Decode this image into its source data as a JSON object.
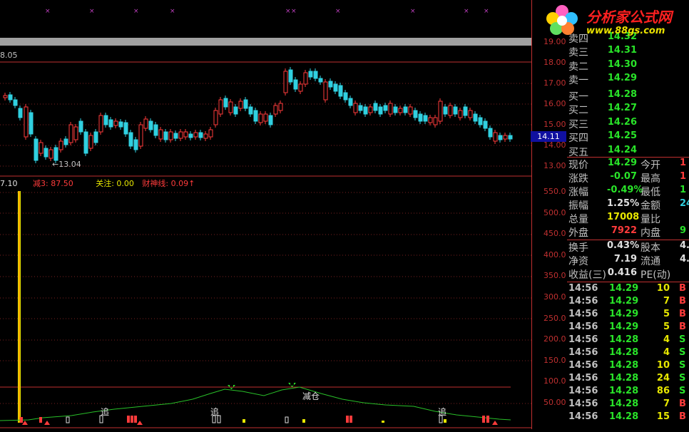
{
  "logo": {
    "title": "分析家公式网",
    "url": "www.88gs.com"
  },
  "main_chart": {
    "top_left_value": "8.05",
    "low_marker": "←13.04",
    "price_tag": "14.11",
    "price_axis": [
      "19.00",
      "18.00",
      "17.00",
      "16.00",
      "15.00",
      "14.00",
      "13.00"
    ]
  },
  "indicator": {
    "legend": [
      {
        "text": "7.10",
        "color": "#e0e0e0"
      },
      {
        "text": "减3: 87.50",
        "color": "#ff3b3b"
      },
      {
        "text": "关注: 0.00",
        "color": "#e7e700"
      },
      {
        "text": "财神线: 0.09↑",
        "color": "#ff3b3b"
      }
    ],
    "axis": [
      "550.0",
      "500.0",
      "450.0",
      "400.0",
      "350.0",
      "300.0",
      "250.0",
      "200.0",
      "150.0",
      "100.0",
      "50.00"
    ],
    "labels": [
      "追",
      "追",
      "减仓",
      "追"
    ]
  },
  "order_book": {
    "partial_top": "卖四",
    "partial_top_val": "14.32",
    "rows": [
      {
        "label": "卖三",
        "value": "14.31"
      },
      {
        "label": "卖二",
        "value": "14.30"
      },
      {
        "label": "卖一",
        "value": "14.29"
      },
      {
        "label": "买一",
        "value": "14.28"
      },
      {
        "label": "买二",
        "value": "14.27"
      },
      {
        "label": "买三",
        "value": "14.26"
      },
      {
        "label": "买四",
        "value": "14.25"
      },
      {
        "label": "买五",
        "value": "14.24"
      }
    ]
  },
  "quote": {
    "rows": [
      {
        "l1": "现价",
        "v1": "14.29",
        "c1": "#29e329",
        "l2": "今开",
        "v2": "1",
        "c2": "#ff3b3b"
      },
      {
        "l1": "涨跌",
        "v1": "-0.07",
        "c1": "#29e329",
        "l2": "最高",
        "v2": "1",
        "c2": "#ff3b3b"
      },
      {
        "l1": "涨幅",
        "v1": "-0.49%",
        "c1": "#29e329",
        "l2": "最低",
        "v2": "1",
        "c2": "#29e329"
      },
      {
        "l1": "振幅",
        "v1": "1.25%",
        "c1": "#e0e0e0",
        "l2": "金额",
        "v2": "24",
        "c2": "#30d0e0"
      },
      {
        "l1": "总量",
        "v1": "17008",
        "c1": "#e7e700",
        "l2": "量比",
        "v2": "",
        "c2": "#e0e0e0"
      },
      {
        "l1": "外盘",
        "v1": "7922",
        "c1": "#ff3b3b",
        "l2": "内盘",
        "v2": "9",
        "c2": "#29e329"
      }
    ],
    "rows2": [
      {
        "l1": "换手",
        "v1": "0.43%",
        "l2": "股本",
        "v2": "4."
      },
      {
        "l1": "净资",
        "v1": "7.19",
        "l2": "流通",
        "v2": "4."
      },
      {
        "l1": "收益(三)",
        "v1": "0.416",
        "l2": "PE(动)",
        "v2": ""
      }
    ]
  },
  "ticks": [
    {
      "time": "14:56",
      "price": "14.29",
      "vol": "10",
      "side": "B"
    },
    {
      "time": "14:56",
      "price": "14.29",
      "vol": "7",
      "side": "B"
    },
    {
      "time": "14:56",
      "price": "14.29",
      "vol": "5",
      "side": "B"
    },
    {
      "time": "14:56",
      "price": "14.29",
      "vol": "5",
      "side": "B"
    },
    {
      "time": "14:56",
      "price": "14.28",
      "vol": "4",
      "side": "S"
    },
    {
      "time": "14:56",
      "price": "14.28",
      "vol": "4",
      "side": "S"
    },
    {
      "time": "14:56",
      "price": "14.28",
      "vol": "10",
      "side": "S"
    },
    {
      "time": "14:56",
      "price": "14.28",
      "vol": "24",
      "side": "S"
    },
    {
      "time": "14:56",
      "price": "14.28",
      "vol": "86",
      "side": "S"
    },
    {
      "time": "14:56",
      "price": "14.28",
      "vol": "7",
      "side": "B"
    },
    {
      "time": "14:56",
      "price": "14.28",
      "vol": "15",
      "side": "B"
    }
  ],
  "colors": {
    "up": "#ff3b3b",
    "down": "#30d0e0",
    "grid": "#c03030",
    "volume": "#e7e700",
    "line": "#29c029"
  }
}
